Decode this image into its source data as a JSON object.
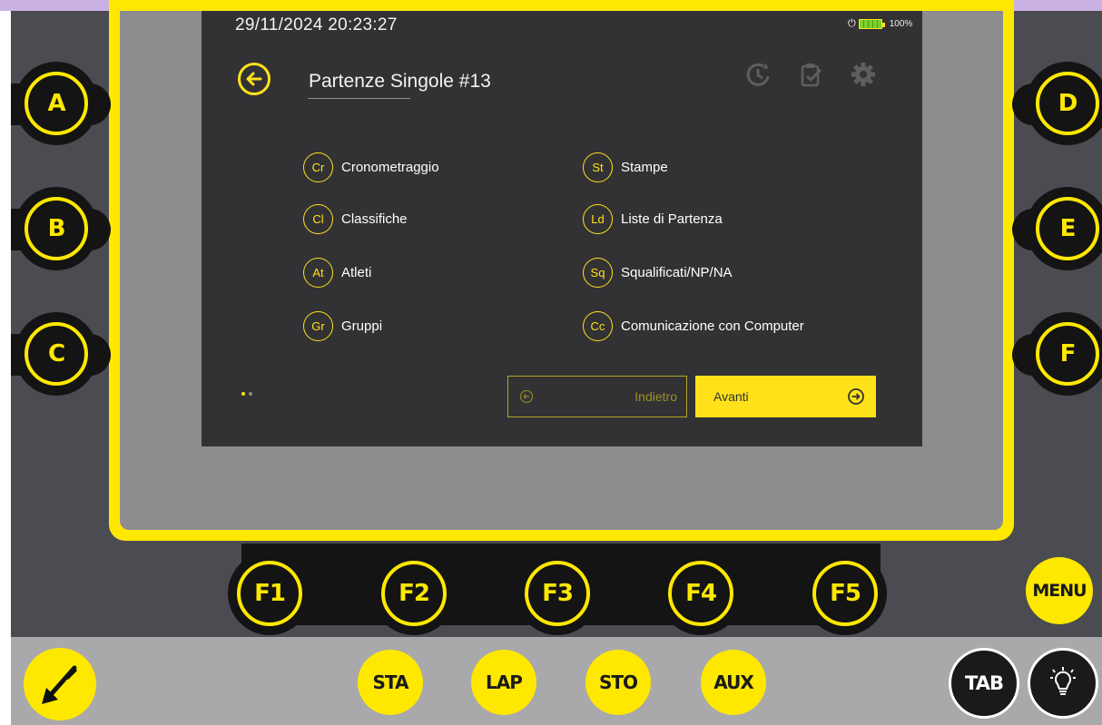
{
  "status_bar": {
    "datetime": "29/11/2024  20:23:27",
    "battery": "100%"
  },
  "header": {
    "title": "Partenze Singole #13"
  },
  "menu_left": [
    {
      "badge": "Cr",
      "label": "Cronometraggio"
    },
    {
      "badge": "Cl",
      "label": "Classifiche"
    },
    {
      "badge": "At",
      "label": "Atleti"
    },
    {
      "badge": "Gr",
      "label": "Gruppi"
    }
  ],
  "menu_right": [
    {
      "badge": "St",
      "label": "Stampe"
    },
    {
      "badge": "Ld",
      "label": "Liste di Partenza"
    },
    {
      "badge": "Sq",
      "label": "Squalificati/NP/NA"
    },
    {
      "badge": "Cc",
      "label": "Comunicazione con Computer"
    }
  ],
  "nav": {
    "back_label": "Indietro",
    "next_label": "Avanti"
  },
  "side_keys": {
    "left": [
      "A",
      "B",
      "C"
    ],
    "right": [
      "D",
      "E",
      "F"
    ]
  },
  "function_keys": [
    "F1",
    "F2",
    "F3",
    "F4",
    "F5"
  ],
  "menu_key": "MENU",
  "bottom_keys": [
    "STA",
    "LAP",
    "STO",
    "AUX"
  ],
  "tab_key": "TAB",
  "colors": {
    "accent": "#ffe11a",
    "screen_bg": "#323234",
    "device": "#4a4c52",
    "band": "#a9a9ab"
  }
}
